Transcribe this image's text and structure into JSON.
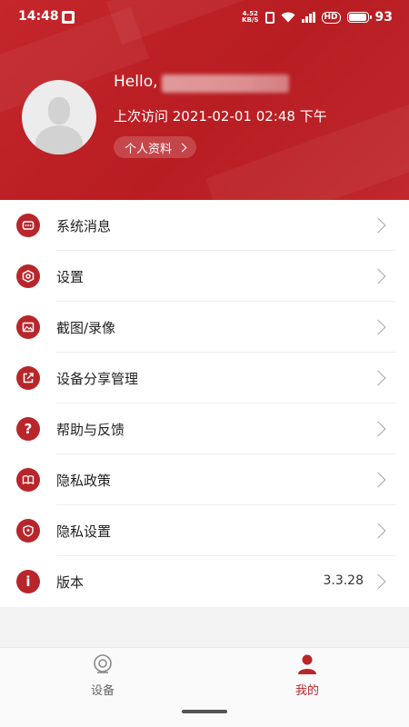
{
  "status_bar": {
    "time": "14:48",
    "net_speed_value": "4.52",
    "net_speed_unit": "KB/S",
    "network_hd": "HD",
    "battery_level": "93"
  },
  "profile": {
    "greeting": "Hello,",
    "last_visit": "上次访问 2021-02-01 02:48 下午",
    "profile_button": "个人资料"
  },
  "menu": {
    "items": [
      {
        "label": "系统消息",
        "icon": "message-icon"
      },
      {
        "label": "设置",
        "icon": "settings-icon"
      },
      {
        "label": "截图/录像",
        "icon": "image-icon"
      },
      {
        "label": "设备分享管理",
        "icon": "share-icon"
      },
      {
        "label": "帮助与反馈",
        "icon": "help-icon"
      },
      {
        "label": "隐私政策",
        "icon": "book-icon"
      },
      {
        "label": "隐私设置",
        "icon": "shield-icon"
      },
      {
        "label": "版本",
        "icon": "info-icon",
        "value": "3.3.28"
      }
    ]
  },
  "bottom_nav": {
    "devices": "设备",
    "mine": "我的"
  },
  "colors": {
    "brand_red": "#b8262b",
    "header_red": "#c4262b",
    "inactive_gray": "#666666"
  }
}
